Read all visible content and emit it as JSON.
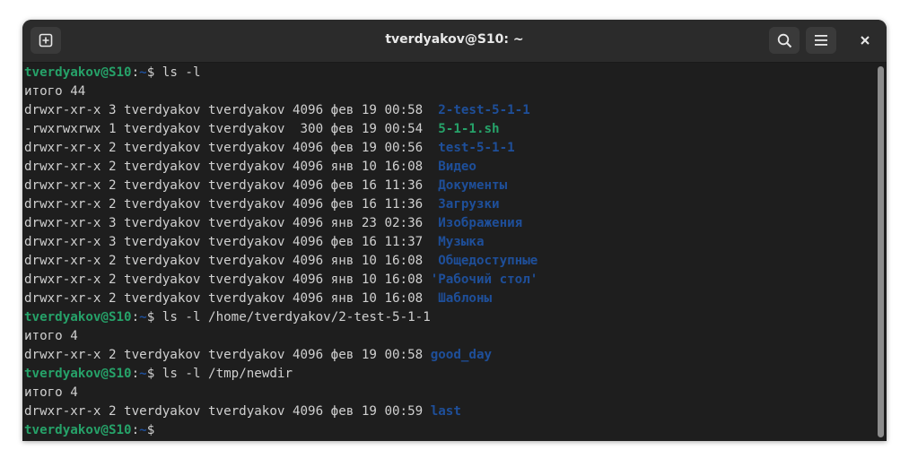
{
  "window": {
    "title": "tverdyakov@S10: ~"
  },
  "toolbar": {
    "new_tab_icon": "new-tab-icon",
    "search_icon": "search-icon",
    "menu_icon": "hamburger-menu-icon",
    "close_icon": "close-icon"
  },
  "colors": {
    "user_prompt": "#26a269",
    "directory": "#1e4f9a",
    "executable": "#26a269",
    "text": "#d0d0d0",
    "background": "#1e1e1e"
  },
  "terminal": {
    "prompt_user": "tverdyakov@S10",
    "prompt_sep": ":",
    "prompt_path": "~",
    "prompt_sigil": "$ ",
    "cmd1": "ls -l",
    "total1": "итого 44",
    "listing1": [
      {
        "meta": "drwxr-xr-x 3 tverdyakov tverdyakov 4096 фев 19 00:58  ",
        "name": "2-test-5-1-1",
        "kind": "dir"
      },
      {
        "meta": "-rwxrwxrwx 1 tverdyakov tverdyakov  300 фев 19 00:54  ",
        "name": "5-1-1.sh",
        "kind": "exe"
      },
      {
        "meta": "drwxr-xr-x 2 tverdyakov tverdyakov 4096 фев 19 00:56  ",
        "name": "test-5-1-1",
        "kind": "dir"
      },
      {
        "meta": "drwxr-xr-x 2 tverdyakov tverdyakov 4096 янв 10 16:08  ",
        "name": "Видео",
        "kind": "dir"
      },
      {
        "meta": "drwxr-xr-x 2 tverdyakov tverdyakov 4096 фев 16 11:36  ",
        "name": "Документы",
        "kind": "dir"
      },
      {
        "meta": "drwxr-xr-x 2 tverdyakov tverdyakov 4096 фев 16 11:36  ",
        "name": "Загрузки",
        "kind": "dir"
      },
      {
        "meta": "drwxr-xr-x 3 tverdyakov tverdyakov 4096 янв 23 02:36  ",
        "name": "Изображения",
        "kind": "dir"
      },
      {
        "meta": "drwxr-xr-x 3 tverdyakov tverdyakov 4096 фев 16 11:37  ",
        "name": "Музыка",
        "kind": "dir"
      },
      {
        "meta": "drwxr-xr-x 2 tverdyakov tverdyakov 4096 янв 10 16:08  ",
        "name": "Общедоступные",
        "kind": "dir"
      },
      {
        "meta": "drwxr-xr-x 2 tverdyakov tverdyakov 4096 янв 10 16:08 ",
        "name": "'Рабочий стол'",
        "kind": "dir"
      },
      {
        "meta": "drwxr-xr-x 2 tverdyakov tverdyakov 4096 янв 10 16:08  ",
        "name": "Шаблоны",
        "kind": "dir"
      }
    ],
    "cmd2": "ls -l /home/tverdyakov/2-test-5-1-1",
    "total2": "итого 4",
    "listing2_meta": "drwxr-xr-x 2 tverdyakov tverdyakov 4096 фев 19 00:58 ",
    "listing2_name": "good_day",
    "cmd3": "ls -l /tmp/newdir",
    "total3": "итого 4",
    "listing3_meta": "drwxr-xr-x 2 tverdyakov tverdyakov 4096 фев 19 00:59 ",
    "listing3_name": "last"
  }
}
